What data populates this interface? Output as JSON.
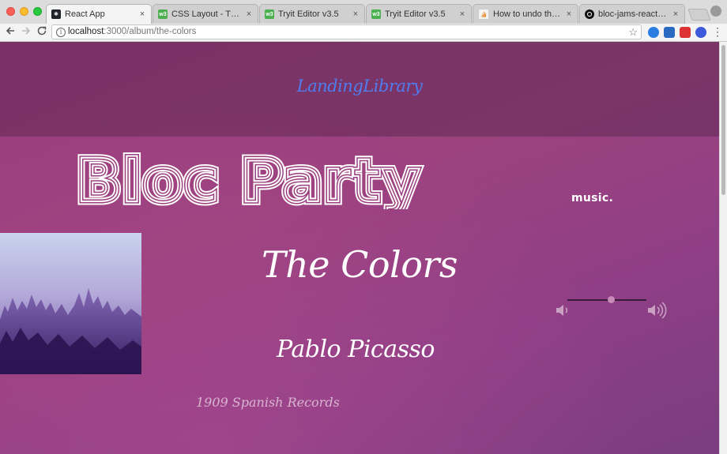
{
  "browser": {
    "tabs": [
      {
        "title": "React App",
        "icon": "react-icon",
        "active": true
      },
      {
        "title": "CSS Layout - The positi",
        "icon": "w3schools-icon"
      },
      {
        "title": "Tryit Editor v3.5",
        "icon": "w3schools-icon"
      },
      {
        "title": "Tryit Editor v3.5",
        "icon": "w3schools-icon"
      },
      {
        "title": "How to undo the most r",
        "icon": "stackoverflow-icon"
      },
      {
        "title": "bloc-jams-react/playerB",
        "icon": "github-icon"
      }
    ],
    "tab_close_glyph": "×",
    "address": {
      "host": "localhost",
      "path": ":3000/album/the-colors"
    }
  },
  "page": {
    "nav_brand": "LandingLibrary",
    "logo_text": "Bloc Party",
    "logo_suffix": "music.",
    "album": {
      "title": "The Colors",
      "artist": "Pablo Picasso",
      "release_info": "1909 Spanish Records"
    },
    "player": {
      "volume_level": 0.55
    }
  },
  "colors": {
    "brand_link": "#4f7df0",
    "page_gradient_top": "#9a3d7e",
    "page_gradient_bottom": "#7a3d7f"
  }
}
